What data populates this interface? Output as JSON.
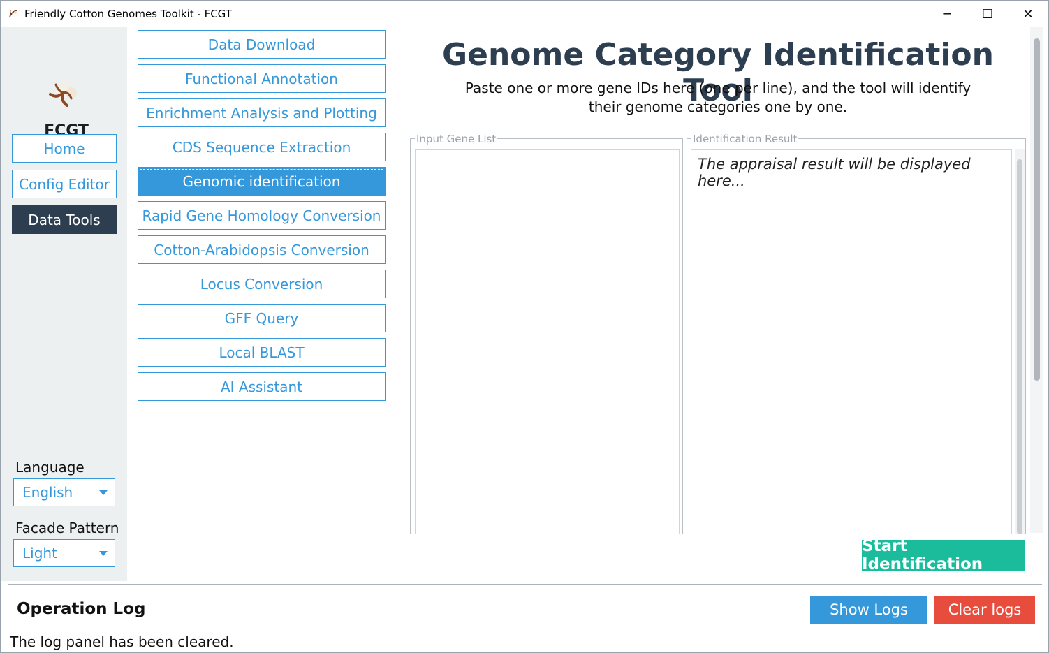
{
  "window": {
    "title": "Friendly Cotton Genomes Toolkit - FCGT",
    "minimize_glyph": "─",
    "maximize_glyph": "☐",
    "close_glyph": "✕"
  },
  "sidebar": {
    "brand": "FCGT",
    "items": [
      {
        "label": "Home",
        "active": false
      },
      {
        "label": "Config Editor",
        "active": false
      },
      {
        "label": "Data Tools",
        "active": true
      }
    ],
    "language_label": "Language",
    "language_value": "English",
    "facade_label": "Facade Pattern",
    "facade_value": "Light"
  },
  "tools": [
    {
      "label": "Data Download",
      "active": false
    },
    {
      "label": "Functional Annotation",
      "active": false
    },
    {
      "label": "Enrichment Analysis and Plotting",
      "active": false
    },
    {
      "label": "CDS Sequence Extraction",
      "active": false
    },
    {
      "label": "Genomic identification",
      "active": true
    },
    {
      "label": "Rapid Gene Homology Conversion",
      "active": false
    },
    {
      "label": "Cotton-Arabidopsis Conversion",
      "active": false
    },
    {
      "label": "Locus Conversion",
      "active": false
    },
    {
      "label": "GFF Query",
      "active": false
    },
    {
      "label": "Local BLAST",
      "active": false
    },
    {
      "label": "AI Assistant",
      "active": false
    }
  ],
  "main": {
    "heading": "Genome Category Identification Tool",
    "description_line1": "Paste one or more gene IDs here (one per line), and the tool will identify",
    "description_line2": "their genome categories one by one.",
    "input_group_title": "Input Gene List",
    "input_value": "",
    "result_group_title": "Identification Result",
    "result_placeholder": "The appraisal result will be displayed here...",
    "start_button": "Start Identification"
  },
  "log": {
    "title": "Operation Log",
    "message": "The log panel has been cleared.",
    "show_button": "Show Logs",
    "clear_button": "Clear logs"
  },
  "colors": {
    "accent": "#3498db",
    "dark": "#2c3e50",
    "success": "#1abc9c",
    "danger": "#e74c3c",
    "sidebar_bg": "#ecf0f1"
  }
}
